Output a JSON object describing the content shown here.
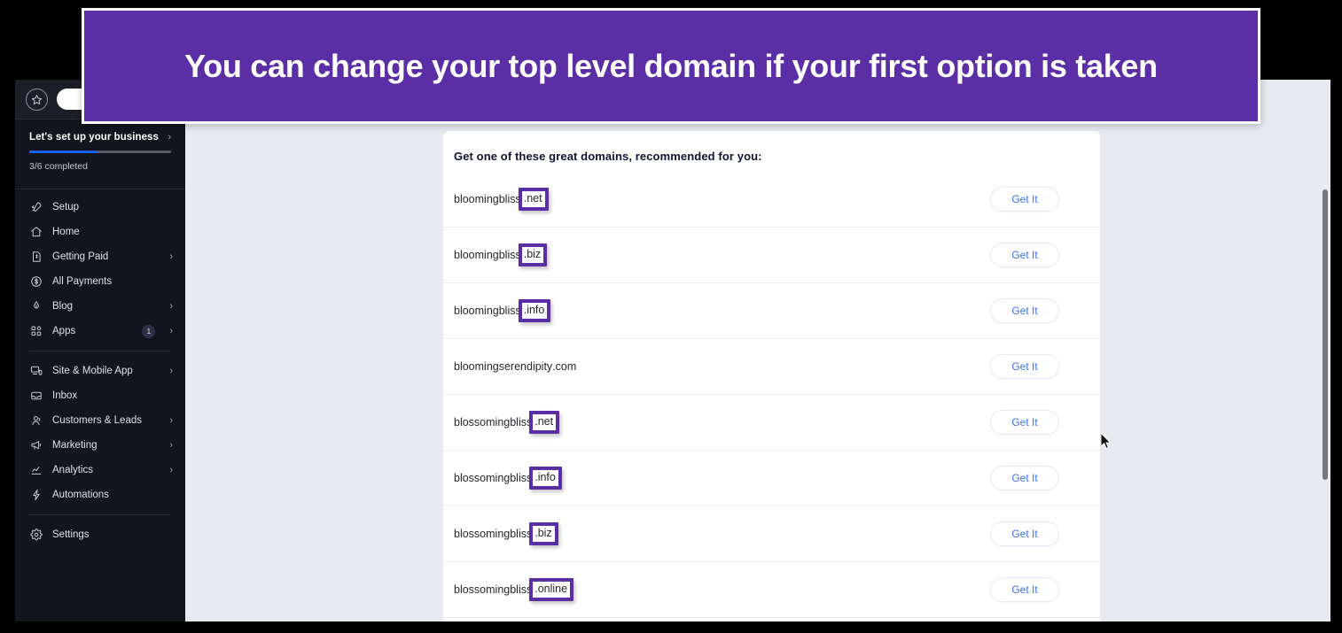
{
  "banner": {
    "text": "You can change your top level domain if your first option is taken",
    "background_color": "#5b2ea6",
    "text_color": "#ffffff"
  },
  "sidebar": {
    "background_color": "#12151e",
    "star_icon": "star-icon",
    "setup": {
      "title": "Let's set up your business",
      "chevron": "›",
      "progress_label": "3/6 completed",
      "progress_percent": 48,
      "progress_color": "#1460f0"
    },
    "items": [
      {
        "label": "Setup",
        "icon": "rocket-icon",
        "chevron": "",
        "badge": ""
      },
      {
        "label": "Home",
        "icon": "home-icon",
        "chevron": "",
        "badge": ""
      },
      {
        "label": "Getting Paid",
        "icon": "receipt-icon",
        "chevron": "›",
        "badge": ""
      },
      {
        "label": "All Payments",
        "icon": "dollar-circle-icon",
        "chevron": "",
        "badge": ""
      },
      {
        "label": "Blog",
        "icon": "pen-icon",
        "chevron": "›",
        "badge": ""
      },
      {
        "label": "Apps",
        "icon": "apps-grid-icon",
        "chevron": "›",
        "badge": "1"
      },
      {
        "label": "Site & Mobile App",
        "icon": "monitor-icon",
        "chevron": "›",
        "badge": ""
      },
      {
        "label": "Inbox",
        "icon": "inbox-icon",
        "chevron": "",
        "badge": ""
      },
      {
        "label": "Customers & Leads",
        "icon": "people-icon",
        "chevron": "›",
        "badge": ""
      },
      {
        "label": "Marketing",
        "icon": "megaphone-icon",
        "chevron": "›",
        "badge": ""
      },
      {
        "label": "Analytics",
        "icon": "chart-icon",
        "chevron": "›",
        "badge": ""
      },
      {
        "label": "Automations",
        "icon": "bolt-icon",
        "chevron": "",
        "badge": ""
      },
      {
        "label": "Settings",
        "icon": "gear-icon",
        "chevron": "",
        "badge": ""
      }
    ]
  },
  "main": {
    "heading": "Get one of these great domains, recommended for you:",
    "button_label": "Get It",
    "highlight_color": "#5b2ea6",
    "link_color": "#3b72f0",
    "domains": [
      {
        "sld": "bloomingbliss",
        "tld": ".net",
        "highlighted": true,
        "action": "Get It"
      },
      {
        "sld": "bloomingbliss",
        "tld": ".biz",
        "highlighted": true,
        "action": "Get It"
      },
      {
        "sld": "bloomingbliss",
        "tld": ".info",
        "highlighted": true,
        "action": "Get It"
      },
      {
        "sld": "bloomingserendipity",
        "tld": ".com",
        "highlighted": false,
        "action": "Get It"
      },
      {
        "sld": "blossomingbliss",
        "tld": ".net",
        "highlighted": true,
        "action": "Get It"
      },
      {
        "sld": "blossomingbliss",
        "tld": ".info",
        "highlighted": true,
        "action": "Get It"
      },
      {
        "sld": "blossomingbliss",
        "tld": ".biz",
        "highlighted": true,
        "action": "Get It"
      },
      {
        "sld": "blossomingbliss",
        "tld": ".online",
        "highlighted": true,
        "action": "Get It"
      }
    ]
  }
}
